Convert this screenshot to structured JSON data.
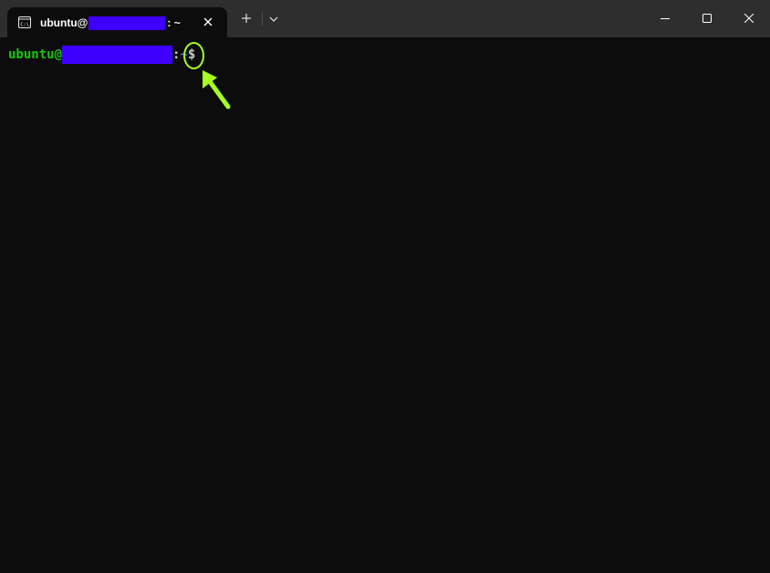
{
  "tab": {
    "icon": "terminal-icon",
    "title_prefix": "ubuntu@",
    "title_suffix": ": ~"
  },
  "tabbar": {
    "new_tab_icon": "plus-icon",
    "dropdown_icon": "chevron-down-icon"
  },
  "window_controls": {
    "minimize_icon": "minimize-icon",
    "maximize_icon": "maximize-icon",
    "close_icon": "close-icon"
  },
  "terminal": {
    "prompt_user": "ubuntu@",
    "prompt_colon": ":",
    "prompt_path": "~",
    "prompt_symbol": "$"
  },
  "colors": {
    "background": "#0c0c0c",
    "titlebar": "#2e2e2e",
    "user_green": "#16c60c",
    "path_blue": "#3b78ff",
    "redaction": "#3d00ff",
    "annotation": "#a5ff20"
  }
}
